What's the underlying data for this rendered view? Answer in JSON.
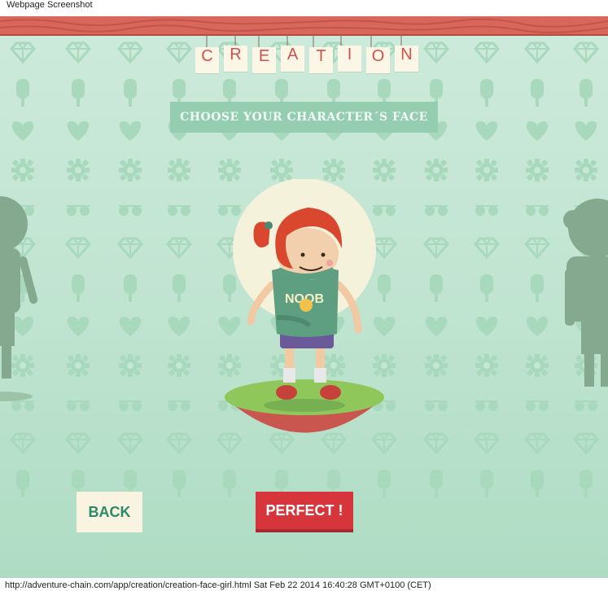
{
  "window": {
    "caption": "Webpage Screenshot"
  },
  "header": {
    "title_letters": [
      "C",
      "R",
      "E",
      "A",
      "T",
      "I",
      "O",
      "N"
    ]
  },
  "instructions": {
    "text": "CHOOSE YOUR CHARACTER´S FACE"
  },
  "character": {
    "shirt_text": "NOOB"
  },
  "buttons": {
    "back_label": "BACK",
    "perfect_label": "PERFECT !"
  },
  "footer": {
    "url_line": "http://adventure-chain.com/app/creation/creation-face-girl.html Sat Feb 22 2014 16:40:28 GMT+0100 (CET)"
  },
  "colors": {
    "background": "#c2e5d2",
    "pattern": "#a8d9bd",
    "accent_red": "#d6363b",
    "button_cream": "#f8f4e1",
    "brand_green": "#2d8a67"
  },
  "icons": [
    "diamond-icon",
    "popsicle-icon",
    "heart-icon",
    "gear-icon",
    "sunglasses-icon"
  ]
}
